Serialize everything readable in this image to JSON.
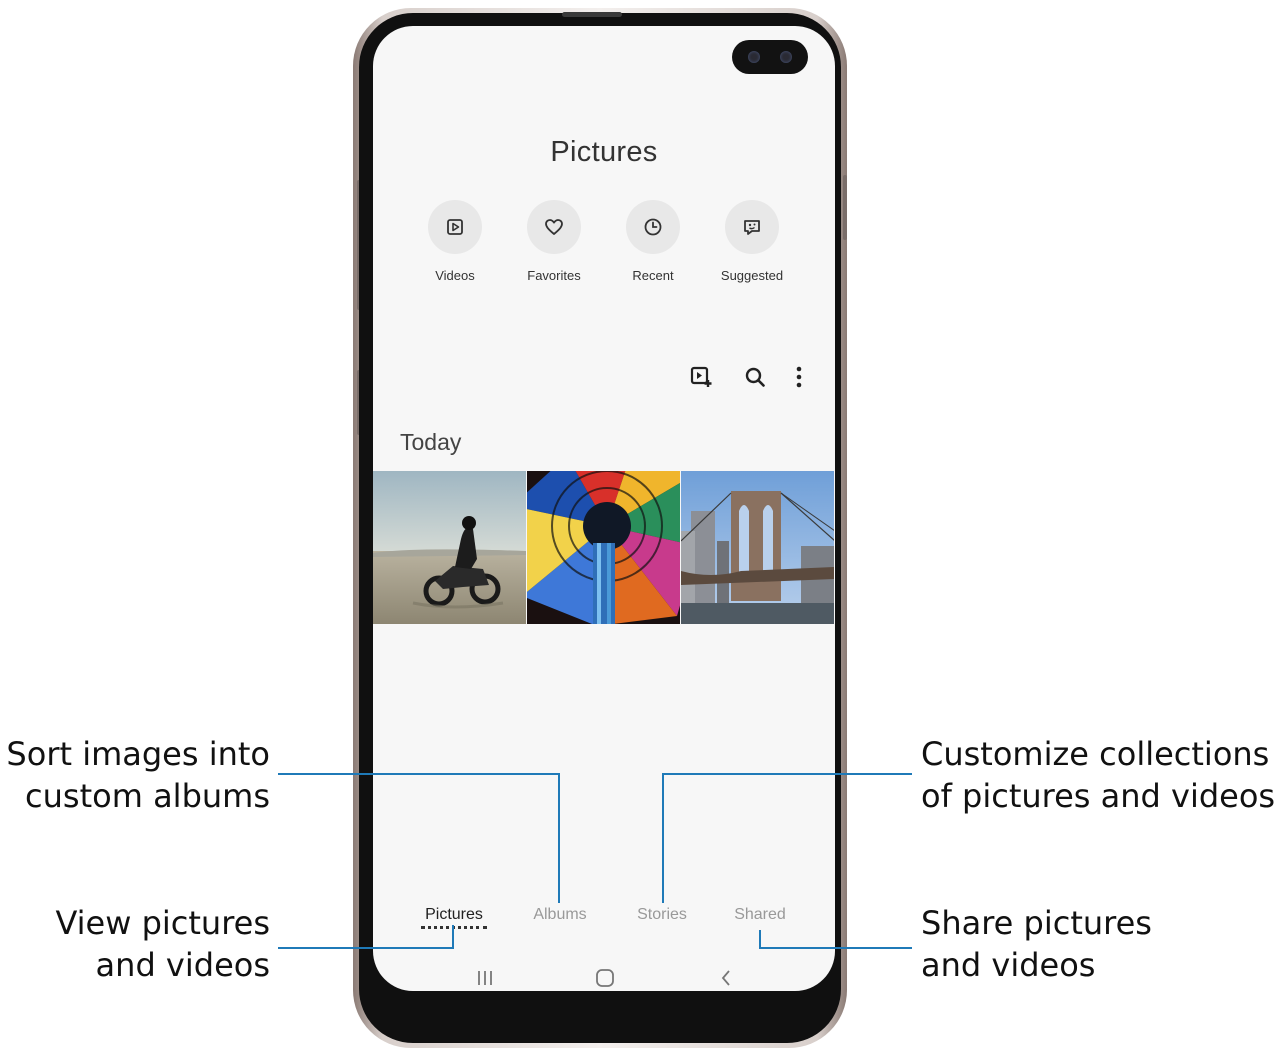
{
  "screen": {
    "title": "Pictures",
    "quick_access": [
      {
        "label": "Videos",
        "icon": "play-icon"
      },
      {
        "label": "Favorites",
        "icon": "heart-icon"
      },
      {
        "label": "Recent",
        "icon": "clock-icon"
      },
      {
        "label": "Suggested",
        "icon": "suggested-icon"
      }
    ],
    "toolbar": {
      "icons": [
        "create-story-icon",
        "search-icon",
        "more-options-icon"
      ]
    },
    "section_label": "Today",
    "thumbnails": [
      "motorcycle-photo",
      "stained-glass-dome-photo",
      "brooklyn-bridge-photo"
    ],
    "bottom_nav": {
      "tabs": [
        "Pictures",
        "Albums",
        "Stories",
        "Shared"
      ],
      "active": "Pictures"
    },
    "system_nav": [
      "recents-icon",
      "home-icon",
      "back-icon"
    ]
  },
  "callouts": {
    "albums": [
      "Sort images into",
      "custom albums"
    ],
    "pictures": [
      "View pictures",
      "and videos"
    ],
    "stories": [
      "Customize collections",
      "of pictures and videos"
    ],
    "shared": [
      "Share pictures",
      "and videos"
    ]
  },
  "colors": {
    "callout_line": "#1f7ab8",
    "screen_bg": "#f7f7f7",
    "icon_circle": "#e8e8e8"
  }
}
